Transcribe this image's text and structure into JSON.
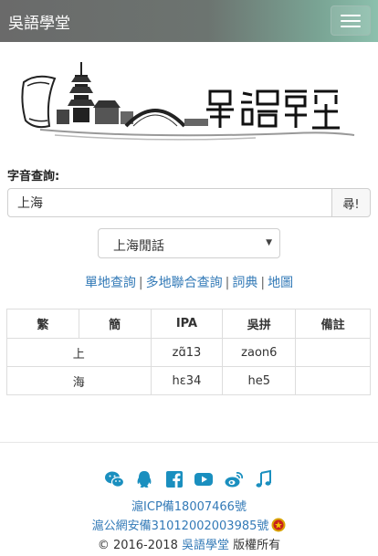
{
  "navbar": {
    "brand": "吳語學堂",
    "menu_icon": "hamburger-menu-icon"
  },
  "logo": {
    "icon": "site-logo-pagoda-bridge",
    "text": "吳語學堂"
  },
  "search": {
    "label": "字音查詢:",
    "value": "上海",
    "button_label": "尋!"
  },
  "dialect_select": {
    "selected": "上海閒話"
  },
  "links": {
    "single": "單地查詢",
    "multi": "多地聯合查詢",
    "dictionary": "詞典",
    "map": "地圖",
    "separator": "|"
  },
  "table": {
    "headers": [
      "繁",
      "簡",
      "IPA",
      "吳拼",
      "備註"
    ],
    "rows": [
      {
        "trad": "上",
        "simp": "",
        "ipa": "zɑ̃13",
        "wupin": "zaon6",
        "note": ""
      },
      {
        "trad": "海",
        "simp": "",
        "ipa": "hɛ34",
        "wupin": "he5",
        "note": ""
      }
    ]
  },
  "footer": {
    "social_icons": [
      "wechat-icon",
      "qq-icon",
      "facebook-icon",
      "youtube-icon",
      "weibo-icon",
      "music-icon"
    ],
    "icp": "滬ICP備18007466號",
    "police_record": "滬公網安備31012002003985號",
    "copyright_prefix": "© 2016-2018",
    "copyright_site": "吳語學堂",
    "copyright_suffix": "版權所有",
    "accent_color": "#1a8fbf"
  }
}
